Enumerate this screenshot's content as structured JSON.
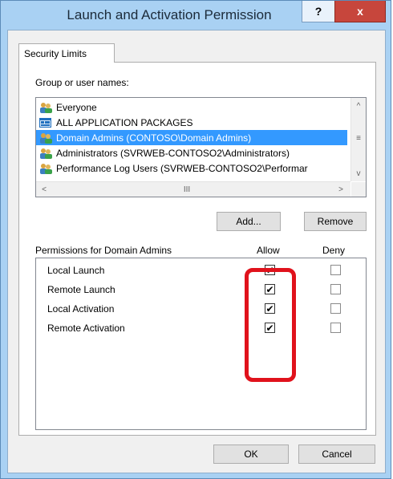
{
  "window": {
    "title": "Launch and Activation Permission",
    "help_label": "?",
    "close_label": "x"
  },
  "tab": {
    "label": "Security Limits"
  },
  "group_label": "Group or user names:",
  "users": [
    {
      "name": "Everyone",
      "icon": "users-icon"
    },
    {
      "name": "ALL APPLICATION PACKAGES",
      "icon": "app-packages-icon"
    },
    {
      "name": "Domain Admins (CONTOSO\\Domain Admins)",
      "icon": "users-icon",
      "selected": true
    },
    {
      "name": "Administrators (SVRWEB-CONTOSO2\\Administrators)",
      "icon": "users-icon"
    },
    {
      "name": "Performance Log Users (SVRWEB-CONTOSO2\\Performar",
      "icon": "users-icon"
    }
  ],
  "buttons": {
    "add": "Add...",
    "remove": "Remove",
    "ok": "OK",
    "cancel": "Cancel"
  },
  "permissions": {
    "title": "Permissions for Domain Admins",
    "allow_header": "Allow",
    "deny_header": "Deny",
    "rows": [
      {
        "name": "Local Launch",
        "allow": true,
        "deny": false
      },
      {
        "name": "Remote Launch",
        "allow": true,
        "deny": false
      },
      {
        "name": "Local Activation",
        "allow": true,
        "deny": false
      },
      {
        "name": "Remote Activation",
        "allow": true,
        "deny": false
      }
    ]
  },
  "scroll": {
    "up": "^",
    "down": "v",
    "left": "<",
    "right": ">",
    "grip_v": "≡",
    "grip_h": "III"
  },
  "colors": {
    "selection": "#3399ff",
    "highlight": "#e0121c",
    "close": "#c7463c",
    "frame": "#a9d1f3"
  }
}
